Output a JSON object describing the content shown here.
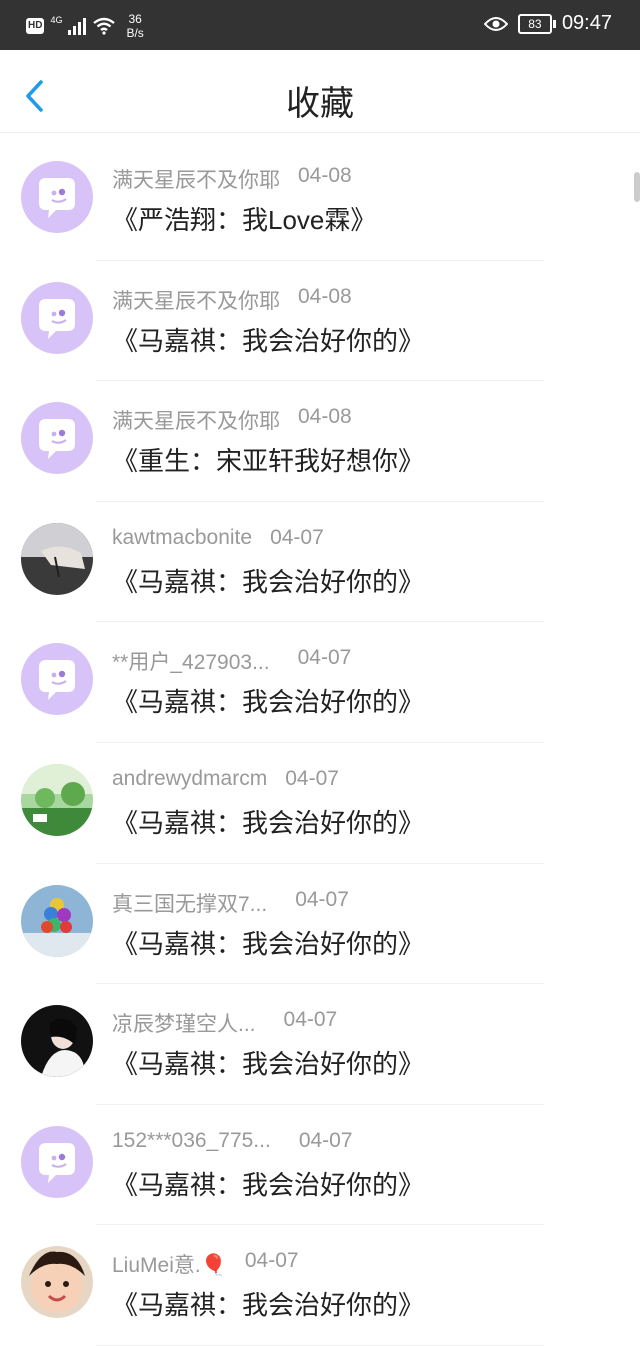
{
  "status_bar": {
    "network_badge": "HD",
    "network_type": "4G",
    "speed_value": "36",
    "speed_unit": "B/s",
    "battery": "83",
    "time": "09:47"
  },
  "header": {
    "title": "收藏",
    "back_icon": "chevron-left-icon"
  },
  "colors": {
    "accent": "#1e9be9",
    "default_avatar_bg": "#d7c3f7",
    "status_bar_bg": "#333333"
  },
  "items": [
    {
      "user": "满天星辰不及你耶",
      "date": "04-08",
      "book": "《严浩翔：我Love霖》",
      "avatar": "default-chat-avatar-icon"
    },
    {
      "user": "满天星辰不及你耶",
      "date": "04-08",
      "book": "《马嘉祺：我会治好你的》",
      "avatar": "default-chat-avatar-icon"
    },
    {
      "user": "满天星辰不及你耶",
      "date": "04-08",
      "book": "《重生：宋亚轩我好想你》",
      "avatar": "default-chat-avatar-icon"
    },
    {
      "user": "kawtmacbonite",
      "date": "04-07",
      "book": "《马嘉祺：我会治好你的》",
      "avatar": "photo-avatar-hand"
    },
    {
      "user": "**用户_427903...",
      "date": "04-07",
      "book": "《马嘉祺：我会治好你的》",
      "avatar": "default-chat-avatar-icon"
    },
    {
      "user": "andrewydmarcm",
      "date": "04-07",
      "book": "《马嘉祺：我会治好你的》",
      "avatar": "photo-avatar-garden"
    },
    {
      "user": "真三国无撑双7...",
      "date": "04-07",
      "book": "《马嘉祺：我会治好你的》",
      "avatar": "photo-avatar-balloons"
    },
    {
      "user": "凉辰梦瑾空人...",
      "date": "04-07",
      "book": "《马嘉祺：我会治好你的》",
      "avatar": "photo-avatar-girl"
    },
    {
      "user": "152***036_775...",
      "date": "04-07",
      "book": "《马嘉祺：我会治好你的》",
      "avatar": "default-chat-avatar-icon"
    },
    {
      "user": "LiuMei意.🎈",
      "date": "04-07",
      "book": "《马嘉祺：我会治好你的》",
      "avatar": "photo-avatar-child"
    }
  ]
}
